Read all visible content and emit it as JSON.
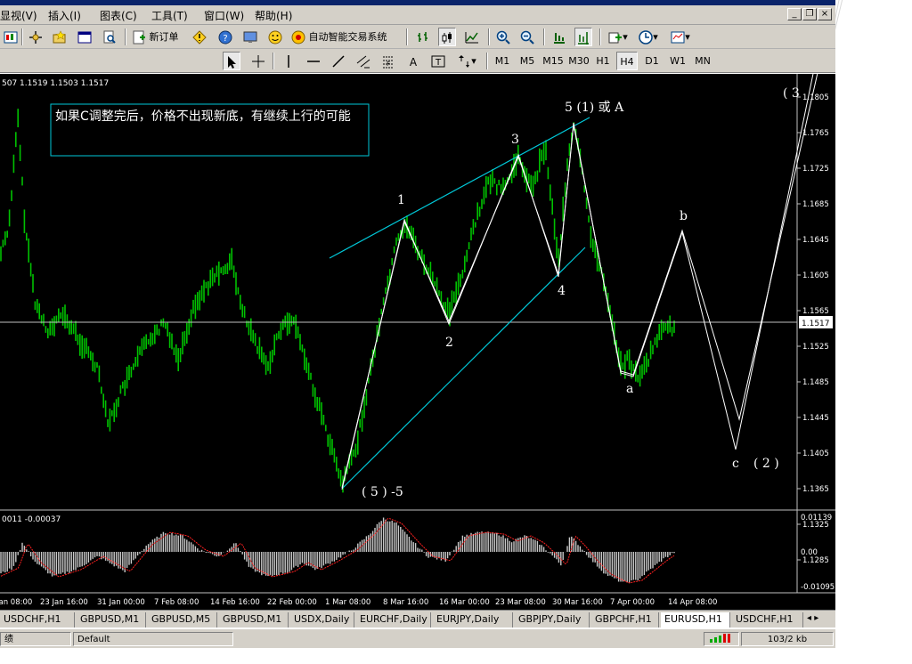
{
  "menu": {
    "items": [
      "显视(V)",
      "插入(I)",
      "图表(C)",
      "工具(T)",
      "窗口(W)",
      "帮助(H)"
    ]
  },
  "toolbar": {
    "new_order": "新订单",
    "expert": "自动智能交易系统",
    "timeframes": [
      "M1",
      "M5",
      "M15",
      "M30",
      "H1",
      "H4",
      "D1",
      "W1",
      "MN"
    ],
    "selected_timeframe": "H4"
  },
  "chart": {
    "ohlc_label": "507 1.1519 1.1503 1.1517",
    "annotation": "如果C调整完后，价格不出现新底，有继续上行的可能",
    "wave_labels": [
      "1",
      "2",
      "3",
      "4",
      "5 (1) 或 A",
      "( 5 ) -5",
      "a",
      "b",
      "c",
      "( 2 )",
      "( 3"
    ],
    "current_price": "1.1517",
    "price_axis": [
      "1.1805",
      "1.1765",
      "1.1725",
      "1.1685",
      "1.1645",
      "1.1605",
      "1.1565",
      "1.1525",
      "1.1485",
      "1.1445",
      "1.1405",
      "1.1365",
      "1.1325",
      "1.1285"
    ],
    "time_axis": [
      "Jan 08:00",
      "23 Jan 16:00",
      "31 Jan 00:00",
      "7 Feb 08:00",
      "14 Feb 16:00",
      "22 Feb 00:00",
      "1 Mar 08:00",
      "8 Mar 16:00",
      "16 Mar 00:00",
      "23 Mar 08:00",
      "30 Mar 16:00",
      "7 Apr 00:00",
      "14 Apr 08:00"
    ],
    "indicator_label": "0011 -0.00037",
    "indicator_axis": [
      "0.01139",
      "0.00",
      "-0.01095"
    ],
    "colors": {
      "candle": "#00c000",
      "trend": "#00c8d8",
      "wave": "#ffffff",
      "osc": "#c8c8c8",
      "signal": "#ff2020"
    }
  },
  "tabs": [
    "USDCHF,H1",
    "GBPUSD,M1",
    "GBPUSD,M5",
    "GBPUSD,M1",
    "USDX,Daily",
    "EURCHF,Daily",
    "EURJPY,Daily",
    "GBPJPY,Daily",
    "GBPCHF,H1",
    "EURUSD,H1",
    "USDCHF,H1"
  ],
  "status": {
    "left": "绩",
    "profile": "Default",
    "traffic": "103/2 kb"
  }
}
